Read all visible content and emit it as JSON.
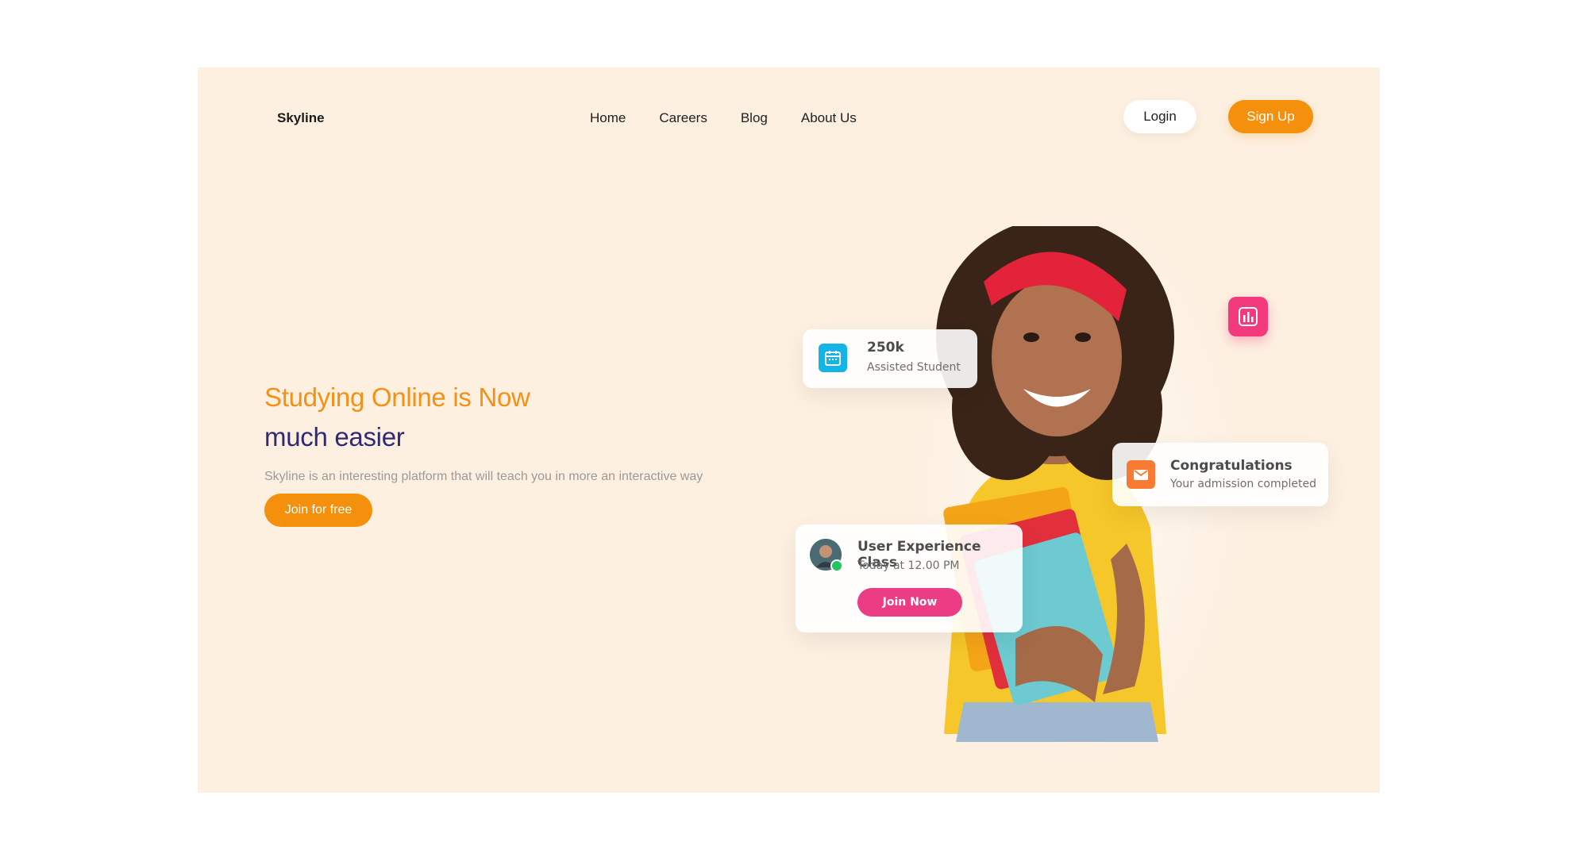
{
  "header": {
    "brand": "Skyline",
    "nav": [
      {
        "label": "Home"
      },
      {
        "label": "Careers"
      },
      {
        "label": "Blog"
      },
      {
        "label": "About Us"
      }
    ],
    "login_label": "Login",
    "signup_label": "Sign Up"
  },
  "hero": {
    "title_line1": "Studying Online is Now",
    "title_line2": "much easier",
    "subtitle": "Skyline is an interesting platform that will teach you in more an interactive way",
    "cta_label": "Join for free"
  },
  "cards": {
    "stat": {
      "value": "250k",
      "label": "Assisted Student",
      "icon": "calendar-icon"
    },
    "congrats": {
      "title": "Congratulations",
      "subtitle": "Your admission completed",
      "icon": "mail-icon"
    },
    "class": {
      "title": "User Experience Class",
      "time": "Today at 12.00 PM",
      "button_label": "Join Now"
    }
  },
  "chart_button": {
    "icon": "bar-chart-icon"
  },
  "colors": {
    "accent_orange": "#f5900c",
    "accent_navy": "#2f2a73",
    "accent_pink": "#ec3c84",
    "accent_cyan": "#13b4e8",
    "background": "#fdf0e1"
  }
}
